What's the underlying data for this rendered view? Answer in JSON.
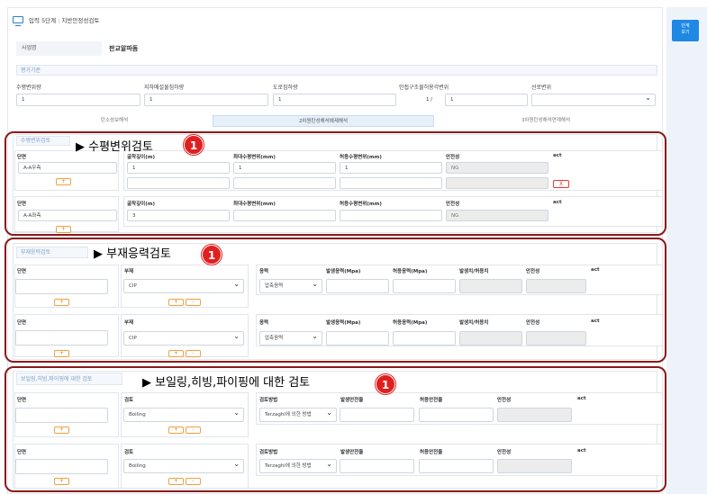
{
  "header": {
    "title": "입력 5단계 : 지반안정성검토"
  },
  "side_button": {
    "label": "단계\n보기"
  },
  "business": {
    "label": "사업명",
    "value": "판교알파돔"
  },
  "criteria": {
    "section_title": "평가기준",
    "labels": [
      "수평변위량",
      "지하매설물침하량",
      "도로침하량",
      "인접구조물허용각변위",
      "선로변위"
    ],
    "values": [
      "1",
      "1",
      "1",
      "1",
      "1"
    ],
    "ratio_prefix": "1 /"
  },
  "tabs": [
    "탄소성보해석",
    "2차원탄성해석예제해석",
    "3차원탄성해석연계해석"
  ],
  "sections": {
    "horizontal": {
      "title": "수평변위검토",
      "annotation": "▶ 수평변위검토",
      "badge": "1",
      "rows": [
        {
          "section_label": "단면",
          "section_value": "A-A우측",
          "headers": [
            "굴착깊이(m)",
            "최대수평변위(mm)",
            "허용수평변위(mm)",
            "안전성",
            "act"
          ],
          "depth": "1",
          "max_disp": "1",
          "allow_disp": "1",
          "safety": "NG",
          "remove": "X"
        },
        {
          "section_label": "단면",
          "section_value": "A-A좌측",
          "headers": [
            "굴착깊이(m)",
            "최대수평변위(mm)",
            "허용수평변위(mm)",
            "안전성",
            "act"
          ],
          "depth": "3",
          "max_disp": "",
          "allow_disp": "",
          "safety": "NG"
        }
      ]
    },
    "member": {
      "title": "부재응력검토",
      "annotation": "▶ 부재응력검토",
      "badge": "1",
      "rows": [
        {
          "section_label": "단면",
          "member_label": "부재",
          "member_value": "CIP",
          "headers": [
            "응력",
            "발생응력(Mpa)",
            "허용응력(Mpa)",
            "발생치/허용치",
            "안전성",
            "act"
          ],
          "stress_value": "압축응력"
        },
        {
          "section_label": "단면",
          "member_label": "부재",
          "member_value": "CIP",
          "headers": [
            "응력",
            "발생응력(Mpa)",
            "허용응력(Mpa)",
            "발생치/허용치",
            "안전성",
            "act"
          ],
          "stress_value": "압축응력"
        }
      ]
    },
    "boiling": {
      "title": "보일링,히빙,파이핑에 대한 검토",
      "annotation": "▶ 보일링,히빙,파이핑에 대한 검토",
      "badge": "1",
      "rows": [
        {
          "section_label": "단면",
          "check_label": "검토",
          "check_value": "Boiling",
          "headers": [
            "검토방법",
            "발생안전율",
            "허용안전율",
            "안전성",
            "act"
          ],
          "method_value": "Terzaghi에 의한 방법"
        },
        {
          "section_label": "단면",
          "check_label": "검토",
          "check_value": "Boiling",
          "headers": [
            "검토방법",
            "발생안전율",
            "허용안전율",
            "안전성",
            "act"
          ],
          "method_value": "Terzaghi에 의한 방법"
        }
      ]
    }
  },
  "buttons": {
    "add": "+",
    "remove_small": "-"
  },
  "colors": {
    "accent": "#1e88e5",
    "annotation_border": "#8b1a1a",
    "badge": "#e02020"
  }
}
